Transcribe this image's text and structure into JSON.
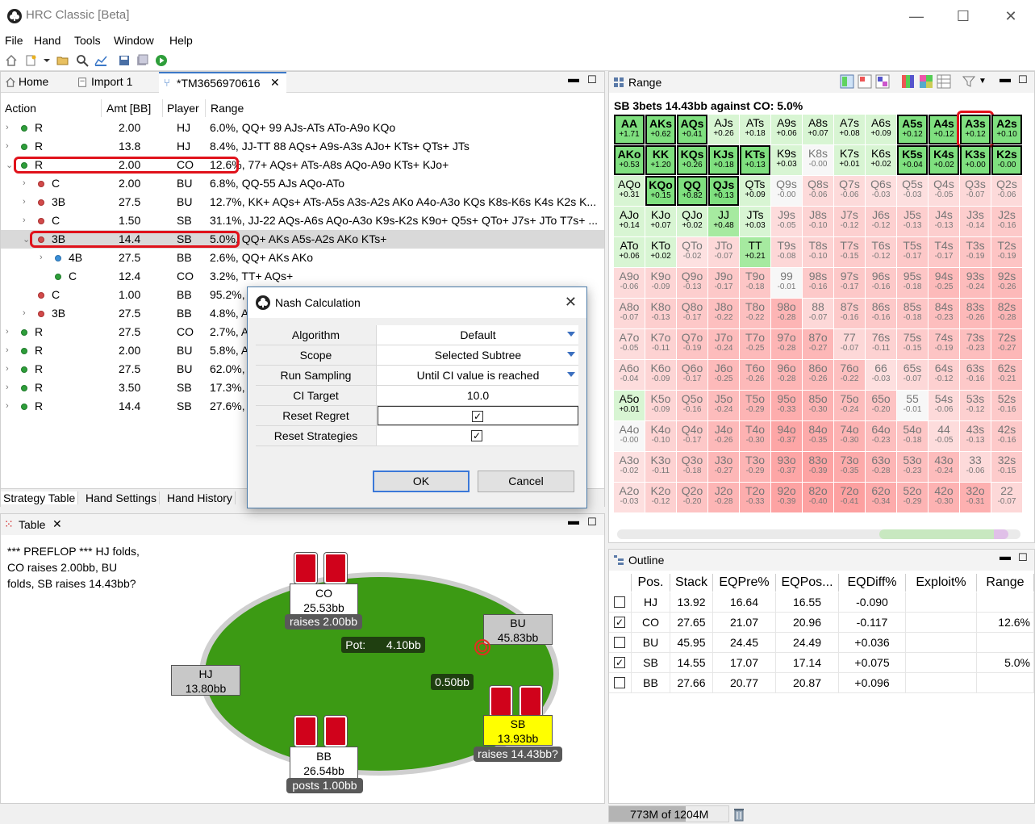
{
  "window": {
    "title": "HRC Classic [Beta]"
  },
  "menu": [
    "File",
    "Hand",
    "Tools",
    "Window",
    "Help"
  ],
  "left_tabs": {
    "home": "Home",
    "import": "Import 1",
    "tree": "*TM3656970616"
  },
  "tree": {
    "headers": {
      "action": "Action",
      "amt": "Amt [BB]",
      "player": "Player",
      "range": "Range"
    },
    "rows": [
      {
        "action": "R",
        "amt": "2.00",
        "player": "HJ",
        "range": "6.0%, QQ+ 99 AJs-ATs ATo-A9o KQo",
        "dot": "g"
      },
      {
        "action": "R",
        "amt": "13.8",
        "player": "HJ",
        "range": "8.4%, JJ-TT 88 AQs+ A9s-A3s AJo+ KTs+ QTs+ JTs",
        "dot": "g"
      },
      {
        "action": "R",
        "amt": "2.00",
        "player": "CO",
        "range": "12.6%, 77+ AQs+ ATs-A8s AQo-A9o KTs+ KJo+",
        "dot": "g"
      },
      {
        "action": "C",
        "amt": "2.00",
        "player": "BU",
        "range": "6.8%, QQ-55 AJs AQo-ATo",
        "dot": "r"
      },
      {
        "action": "3B",
        "amt": "27.5",
        "player": "BU",
        "range": "12.7%, KK+ AQs+ ATs-A5s A3s-A2s AKo A4o-A3o KQs K8s-K6s K4s K2s K...",
        "dot": "r"
      },
      {
        "action": "C",
        "amt": "1.50",
        "player": "SB",
        "range": "31.1%, JJ-22 AQs-A6s AQo-A3o K9s-K2s K9o+ Q5s+ QTo+ J7s+ JTo T7s+ ...",
        "dot": "r"
      },
      {
        "action": "3B",
        "amt": "14.4",
        "player": "SB",
        "range": "5.0%, QQ+ AKs A5s-A2s AKo KTs+",
        "dot": "r"
      },
      {
        "action": "4B",
        "amt": "27.5",
        "player": "BB",
        "range": "2.6%, QQ+ AKs AKo",
        "dot": "b"
      },
      {
        "action": "C",
        "amt": "12.4",
        "player": "CO",
        "range": "3.2%, TT+ AQs+",
        "dot": "g"
      },
      {
        "action": "C",
        "amt": "1.00",
        "player": "BB",
        "range": "95.2%,",
        "dot": "r"
      },
      {
        "action": "3B",
        "amt": "27.5",
        "player": "BB",
        "range": "4.8%, A",
        "dot": "r"
      },
      {
        "action": "R",
        "amt": "27.5",
        "player": "CO",
        "range": "2.7%, A",
        "dot": "g"
      },
      {
        "action": "R",
        "amt": "2.00",
        "player": "BU",
        "range": "5.8%, A",
        "dot": "g"
      },
      {
        "action": "R",
        "amt": "27.5",
        "player": "BU",
        "range": "62.0%,",
        "dot": "g"
      },
      {
        "action": "R",
        "amt": "3.50",
        "player": "SB",
        "range": "17.3%,",
        "dot": "g"
      },
      {
        "action": "R",
        "amt": "14.4",
        "player": "SB",
        "range": "27.6%,",
        "dot": "g"
      }
    ]
  },
  "bottom_tabs": [
    "Strategy Table",
    "Hand Settings",
    "Hand History"
  ],
  "table_tab": "Table",
  "hand_log": "*** PREFLOP *** HJ folds, CO raises 2.00bb, BU folds, SB raises 14.43bb?",
  "poker_table": {
    "pot_label": "Pot:",
    "pot": "4.10bb",
    "bet_sb": "0.50bb",
    "seats": {
      "CO": {
        "name": "CO",
        "stack": "25.53bb",
        "action": "raises 2.00bb"
      },
      "BU": {
        "name": "BU",
        "stack": "45.83bb"
      },
      "HJ": {
        "name": "HJ",
        "stack": "13.80bb"
      },
      "SB": {
        "name": "SB",
        "stack": "13.93bb",
        "action": "raises 14.43bb?"
      },
      "BB": {
        "name": "BB",
        "stack": "26.54bb",
        "action": "posts 1.00bb"
      }
    }
  },
  "range_panel": {
    "tab": "Range",
    "title": "SB 3bets 14.43bb against CO: 5.0%",
    "cells": [
      [
        "AA",
        "+1.71",
        "AKs",
        "+0.62",
        "AQs",
        "+0.41",
        "AJs",
        "+0.26",
        "ATs",
        "+0.18",
        "A9s",
        "+0.06",
        "A8s",
        "+0.07",
        "A7s",
        "+0.08",
        "A6s",
        "+0.09",
        "A5s",
        "+0.12",
        "A4s",
        "+0.12",
        "A3s",
        "+0.12",
        "A2s",
        "+0.10"
      ],
      [
        "AKo",
        "+0.53",
        "KK",
        "+1.20",
        "KQs",
        "+0.26",
        "KJs",
        "+0.18",
        "KTs",
        "+0.13",
        "K9s",
        "+0.03",
        "K8s",
        "-0.00",
        "K7s",
        "+0.01",
        "K6s",
        "+0.02",
        "K5s",
        "+0.04",
        "K4s",
        "+0.02",
        "K3s",
        "+0.00",
        "K2s",
        "-0.00"
      ],
      [
        "AQo",
        "+0.31",
        "KQo",
        "+0.15",
        "QQ",
        "+0.82",
        "QJs",
        "+0.13",
        "QTs",
        "+0.09",
        "Q9s",
        "-0.00",
        "Q8s",
        "-0.06",
        "Q7s",
        "-0.06",
        "Q6s",
        "-0.03",
        "Q5s",
        "-0.03",
        "Q4s",
        "-0.05",
        "Q3s",
        "-0.07",
        "Q2s",
        "-0.06"
      ],
      [
        "AJo",
        "+0.14",
        "KJo",
        "+0.07",
        "QJo",
        "+0.02",
        "JJ",
        "+0.48",
        "JTs",
        "+0.03",
        "J9s",
        "-0.05",
        "J8s",
        "-0.10",
        "J7s",
        "-0.12",
        "J6s",
        "-0.12",
        "J5s",
        "-0.13",
        "J4s",
        "-0.13",
        "J3s",
        "-0.14",
        "J2s",
        "-0.16"
      ],
      [
        "ATo",
        "+0.06",
        "KTo",
        "+0.02",
        "QTo",
        "-0.02",
        "JTo",
        "-0.07",
        "TT",
        "+0.21",
        "T9s",
        "-0.08",
        "T8s",
        "-0.10",
        "T7s",
        "-0.15",
        "T6s",
        "-0.12",
        "T5s",
        "-0.17",
        "T4s",
        "-0.17",
        "T3s",
        "-0.19",
        "T2s",
        "-0.19"
      ],
      [
        "A9o",
        "-0.06",
        "K9o",
        "-0.09",
        "Q9o",
        "-0.13",
        "J9o",
        "-0.17",
        "T9o",
        "-0.18",
        "99",
        "-0.01",
        "98s",
        "-0.16",
        "97s",
        "-0.17",
        "96s",
        "-0.16",
        "95s",
        "-0.18",
        "94s",
        "-0.25",
        "93s",
        "-0.24",
        "92s",
        "-0.26"
      ],
      [
        "A8o",
        "-0.07",
        "K8o",
        "-0.13",
        "Q8o",
        "-0.17",
        "J8o",
        "-0.22",
        "T8o",
        "-0.22",
        "98o",
        "-0.28",
        "88",
        "-0.07",
        "87s",
        "-0.16",
        "86s",
        "-0.16",
        "85s",
        "-0.18",
        "84s",
        "-0.23",
        "83s",
        "-0.26",
        "82s",
        "-0.28"
      ],
      [
        "A7o",
        "-0.05",
        "K7o",
        "-0.11",
        "Q7o",
        "-0.19",
        "J7o",
        "-0.24",
        "T7o",
        "-0.25",
        "97o",
        "-0.28",
        "87o",
        "-0.27",
        "77",
        "-0.07",
        "76s",
        "-0.11",
        "75s",
        "-0.15",
        "74s",
        "-0.19",
        "73s",
        "-0.23",
        "72s",
        "-0.27"
      ],
      [
        "A6o",
        "-0.04",
        "K6o",
        "-0.09",
        "Q6o",
        "-0.17",
        "J6o",
        "-0.25",
        "T6o",
        "-0.26",
        "96o",
        "-0.28",
        "86o",
        "-0.26",
        "76o",
        "-0.22",
        "66",
        "-0.03",
        "65s",
        "-0.07",
        "64s",
        "-0.12",
        "63s",
        "-0.16",
        "62s",
        "-0.21"
      ],
      [
        "A5o",
        "+0.01",
        "K5o",
        "-0.09",
        "Q5o",
        "-0.16",
        "J5o",
        "-0.24",
        "T5o",
        "-0.29",
        "95o",
        "-0.33",
        "85o",
        "-0.30",
        "75o",
        "-0.24",
        "65o",
        "-0.20",
        "55",
        "-0.01",
        "54s",
        "-0.06",
        "53s",
        "-0.12",
        "52s",
        "-0.16"
      ],
      [
        "A4o",
        "-0.00",
        "K4o",
        "-0.10",
        "Q4o",
        "-0.17",
        "J4o",
        "-0.26",
        "T4o",
        "-0.30",
        "94o",
        "-0.37",
        "84o",
        "-0.35",
        "74o",
        "-0.30",
        "64o",
        "-0.23",
        "54o",
        "-0.18",
        "44",
        "-0.05",
        "43s",
        "-0.13",
        "42s",
        "-0.16"
      ],
      [
        "A3o",
        "-0.02",
        "K3o",
        "-0.11",
        "Q3o",
        "-0.18",
        "J3o",
        "-0.27",
        "T3o",
        "-0.29",
        "93o",
        "-0.37",
        "83o",
        "-0.39",
        "73o",
        "-0.35",
        "63o",
        "-0.28",
        "53o",
        "-0.23",
        "43o",
        "-0.24",
        "33",
        "-0.06",
        "32s",
        "-0.15"
      ],
      [
        "A2o",
        "-0.03",
        "K2o",
        "-0.12",
        "Q2o",
        "-0.20",
        "J2o",
        "-0.28",
        "T2o",
        "-0.33",
        "92o",
        "-0.39",
        "82o",
        "-0.40",
        "72o",
        "-0.41",
        "62o",
        "-0.34",
        "52o",
        "-0.29",
        "42o",
        "-0.30",
        "32o",
        "-0.31",
        "22",
        "-0.07"
      ]
    ],
    "bold_cells": [
      "AA",
      "AKs",
      "AQs",
      "A5s",
      "A4s",
      "A3s",
      "A2s",
      "AKo",
      "KK",
      "KQs",
      "KJs",
      "KTs",
      "K5s",
      "K4s",
      "K3s",
      "K2s",
      "KQo",
      "QQ",
      "QJs"
    ],
    "highlight_cell": "A3s"
  },
  "outline": {
    "tab": "Outline",
    "headers": [
      "Pos.",
      "Stack",
      "EQPre%",
      "EQPos...",
      "EQDiff%",
      "Exploit%",
      "Range"
    ],
    "rows": [
      {
        "checked": false,
        "pos": "HJ",
        "stack": "13.92",
        "eqpre": "16.64",
        "eqpos": "16.55",
        "eqdiff": "-0.090",
        "exploit": "",
        "range": ""
      },
      {
        "checked": true,
        "pos": "CO",
        "stack": "27.65",
        "eqpre": "21.07",
        "eqpos": "20.96",
        "eqdiff": "-0.117",
        "exploit": "",
        "range": "12.6%"
      },
      {
        "checked": false,
        "pos": "BU",
        "stack": "45.95",
        "eqpre": "24.45",
        "eqpos": "24.49",
        "eqdiff": "+0.036",
        "exploit": "",
        "range": ""
      },
      {
        "checked": true,
        "pos": "SB",
        "stack": "14.55",
        "eqpre": "17.07",
        "eqpos": "17.14",
        "eqdiff": "+0.075",
        "exploit": "",
        "range": "5.0%"
      },
      {
        "checked": false,
        "pos": "BB",
        "stack": "27.66",
        "eqpre": "20.77",
        "eqpos": "20.87",
        "eqdiff": "+0.096",
        "exploit": "",
        "range": ""
      }
    ]
  },
  "status": {
    "memory": "773M of 1204M",
    "memory_used_fraction": 0.642
  },
  "dialog": {
    "title": "Nash Calculation",
    "fields": [
      {
        "label": "Algorithm",
        "value": "Default",
        "dropdown": true
      },
      {
        "label": "Scope",
        "value": "Selected Subtree",
        "dropdown": true
      },
      {
        "label": "Run Sampling",
        "value": "Until CI value is reached",
        "dropdown": true
      },
      {
        "label": "CI Target",
        "value": "10.0",
        "dropdown": false
      },
      {
        "label": "Reset Regret",
        "value": "✓",
        "checkbox": true
      },
      {
        "label": "Reset Strategies",
        "value": "✓",
        "checkbox": true
      }
    ],
    "ok": "OK",
    "cancel": "Cancel"
  },
  "colors": {
    "accent": "#3b78c8",
    "felt": "#3c9a14",
    "highlight_red": "#e0121b",
    "card_red": "#d0021b"
  }
}
